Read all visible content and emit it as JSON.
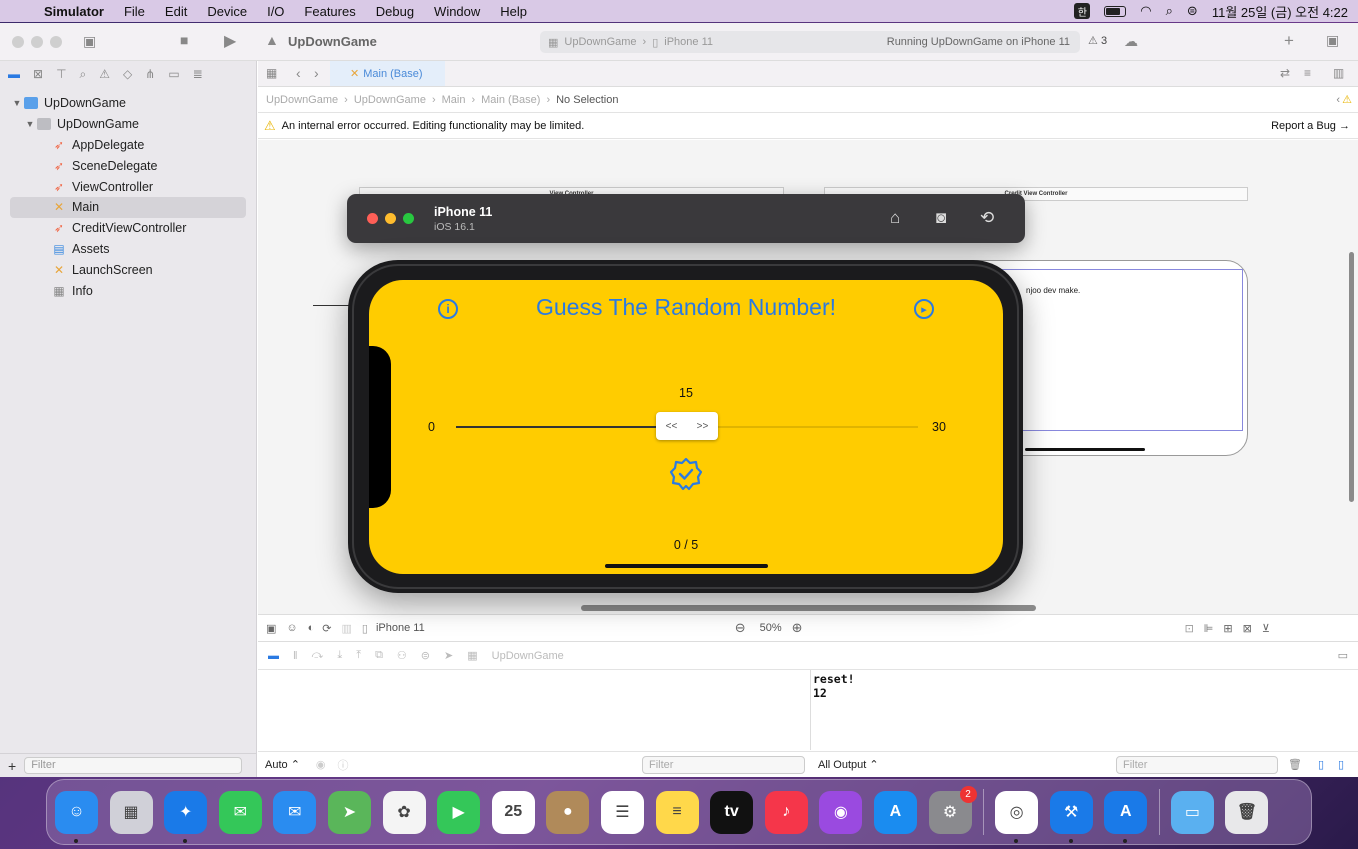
{
  "menubar": {
    "app": "Simulator",
    "items": [
      "File",
      "Edit",
      "Device",
      "I/O",
      "Features",
      "Debug",
      "Window",
      "Help"
    ],
    "ime": "한",
    "clock": "11월 25일 (금) 오전  4:22"
  },
  "toolbar": {
    "project": "UpDownGame",
    "scheme": "UpDownGame",
    "device": "iPhone 11",
    "status": "Running UpDownGame on iPhone 11",
    "warnings": "3"
  },
  "sidebar": {
    "project": "UpDownGame",
    "group": "UpDownGame",
    "items": [
      {
        "label": "AppDelegate",
        "kind": "swift"
      },
      {
        "label": "SceneDelegate",
        "kind": "swift"
      },
      {
        "label": "ViewController",
        "kind": "swift"
      },
      {
        "label": "Main",
        "kind": "storyboard",
        "selected": true
      },
      {
        "label": "CreditViewController",
        "kind": "swift"
      },
      {
        "label": "Assets",
        "kind": "assets"
      },
      {
        "label": "LaunchScreen",
        "kind": "storyboard"
      },
      {
        "label": "Info",
        "kind": "plist"
      }
    ],
    "filter_placeholder": "Filter"
  },
  "editor": {
    "tab": "Main (Base)",
    "jumpbar": [
      "UpDownGame",
      "UpDownGame",
      "Main",
      "Main (Base)",
      "No Selection"
    ],
    "warning": "An internal error occurred. Editing functionality may be limited.",
    "report_bug": "Report a Bug",
    "scene_vc": "View Controller",
    "scene_credit": "Credit View Controller",
    "credit_text": "njoo dev make.",
    "device_label": "iPhone 11",
    "zoom": "50%"
  },
  "debug": {
    "target": "UpDownGame",
    "console_lines": "reset!\n12",
    "auto_label": "Auto",
    "filter_left": "Filter",
    "output_label": "All Output",
    "filter_right": "Filter"
  },
  "simulator": {
    "device": "iPhone 11",
    "os": "iOS 16.1",
    "title": "Guess The Random Number!",
    "slider_value": "15",
    "slider_min": "0",
    "slider_max": "30",
    "slider_fraction": 0.5,
    "thumb_left": "<<",
    "thumb_right": ">>",
    "tries": "0 / 5",
    "colors": {
      "background": "#ffcc00",
      "accent": "#2a7ae2"
    }
  },
  "dock": {
    "apps": [
      {
        "name": "finder",
        "color": "#2a8cf0",
        "glyph": "☺",
        "running": true
      },
      {
        "name": "launchpad",
        "color": "#d0d0d8",
        "glyph": "▦",
        "running": false
      },
      {
        "name": "safari",
        "color": "#1a7ae8",
        "glyph": "✦",
        "running": true
      },
      {
        "name": "messages",
        "color": "#34c759",
        "glyph": "✉",
        "running": false
      },
      {
        "name": "mail",
        "color": "#2a8cf0",
        "glyph": "✉",
        "running": false
      },
      {
        "name": "maps",
        "color": "#5ab65a",
        "glyph": "➤",
        "running": false
      },
      {
        "name": "photos",
        "color": "#f4f4f4",
        "glyph": "✿",
        "running": false
      },
      {
        "name": "facetime",
        "color": "#34c759",
        "glyph": "▶",
        "running": false
      },
      {
        "name": "calendar",
        "color": "#ffffff",
        "glyph": "25",
        "running": false
      },
      {
        "name": "contacts",
        "color": "#b08a5a",
        "glyph": "●",
        "running": false
      },
      {
        "name": "reminders",
        "color": "#ffffff",
        "glyph": "☰",
        "running": false
      },
      {
        "name": "notes",
        "color": "#ffd84a",
        "glyph": "≡",
        "running": false
      },
      {
        "name": "appletv",
        "color": "#111111",
        "glyph": "tv",
        "running": false
      },
      {
        "name": "music",
        "color": "#f5364a",
        "glyph": "♪",
        "running": false
      },
      {
        "name": "podcasts",
        "color": "#9a4ae0",
        "glyph": "◉",
        "running": false
      },
      {
        "name": "appstore",
        "color": "#1a8cf0",
        "glyph": "A",
        "running": false
      },
      {
        "name": "system-settings",
        "color": "#8a8a8e",
        "glyph": "⚙",
        "running": false,
        "badge": "2"
      },
      {
        "sep": true
      },
      {
        "name": "chrome",
        "color": "#ffffff",
        "glyph": "◎",
        "running": true
      },
      {
        "name": "xcode",
        "color": "#1a7ae8",
        "glyph": "⚒",
        "running": true
      },
      {
        "name": "simulator",
        "color": "#1a7ae8",
        "glyph": "A",
        "running": true
      },
      {
        "sep": true
      },
      {
        "name": "downloads-folder",
        "color": "#5ab0f0",
        "glyph": "▭",
        "running": false
      },
      {
        "name": "trash",
        "color": "#e8e8ea",
        "glyph": "🗑",
        "running": false
      }
    ]
  }
}
